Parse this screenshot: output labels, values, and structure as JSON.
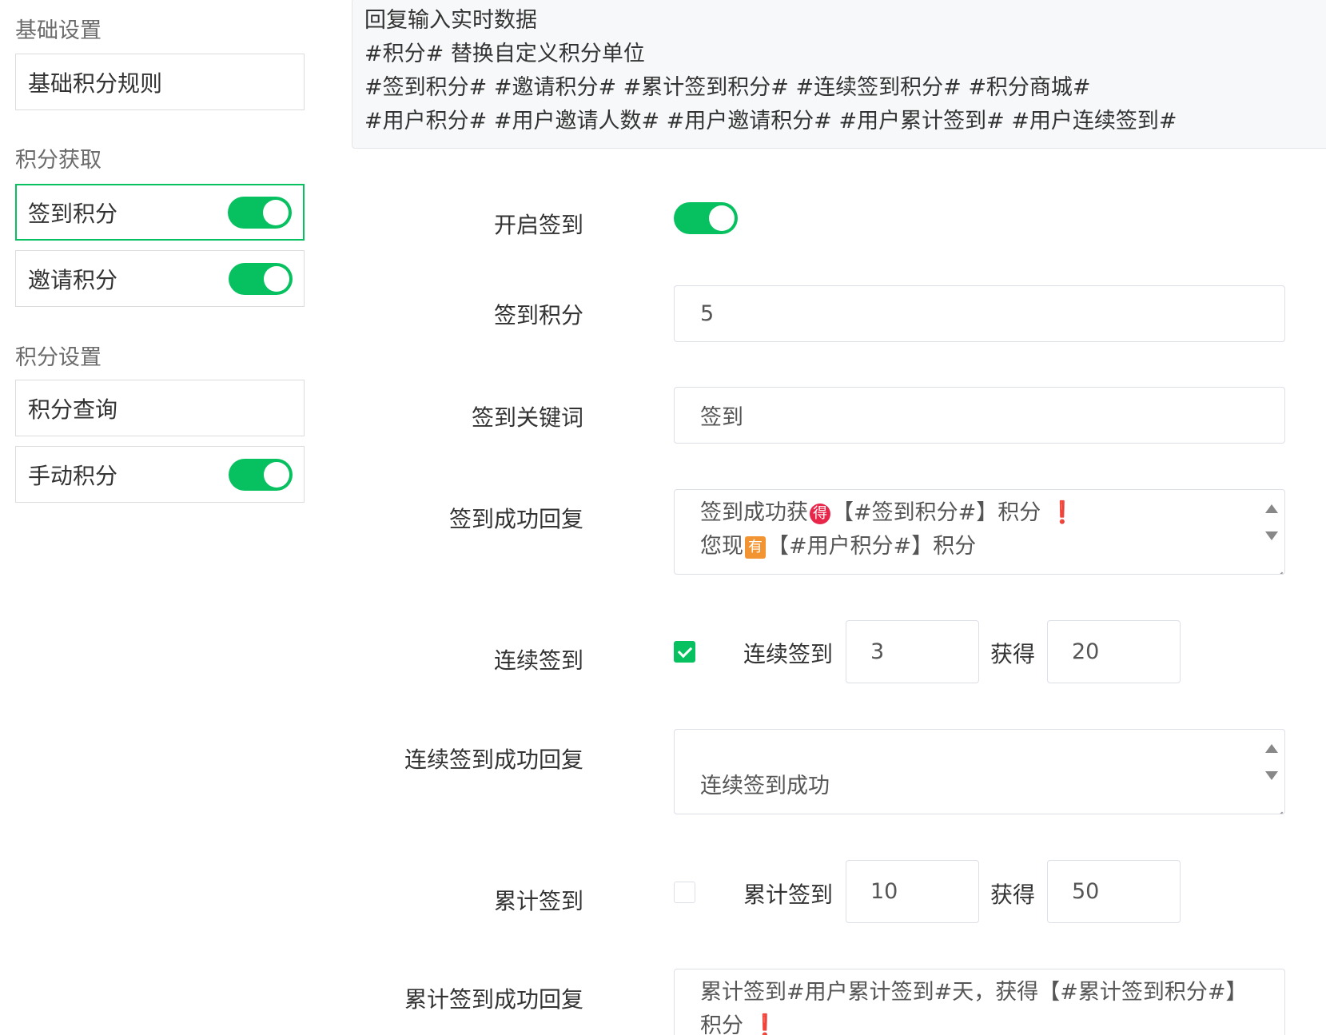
{
  "sidebar": {
    "sections": [
      {
        "title": "基础设置",
        "items": [
          {
            "label": "基础积分规则",
            "toggle": false
          }
        ]
      },
      {
        "title": "积分获取",
        "items": [
          {
            "label": "签到积分",
            "toggle": true,
            "active": true
          },
          {
            "label": "邀请积分",
            "toggle": true
          }
        ]
      },
      {
        "title": "积分设置",
        "items": [
          {
            "label": "积分查询",
            "toggle": false
          },
          {
            "label": "手动积分",
            "toggle": true
          }
        ]
      }
    ]
  },
  "hint": {
    "lines": [
      "回复输入实时数据",
      "#积分# 替换自定义积分单位",
      "#签到积分# #邀请积分# #累计签到积分# #连续签到积分# #积分商城#",
      "#用户积分# #用户邀请人数# #用户邀请积分# #用户累计签到# #用户连续签到#"
    ]
  },
  "form": {
    "enable_checkin": {
      "label": "开启签到",
      "on": true
    },
    "checkin_points": {
      "label": "签到积分",
      "value": "5"
    },
    "checkin_keyword": {
      "label": "签到关键词",
      "value": "签到"
    },
    "checkin_reply": {
      "label": "签到成功回复",
      "line1_a": "签到成功获",
      "line1_emoji": "得",
      "line1_b": "【#签到积分#】积分",
      "line1_excl": "❗",
      "line2_a": "您现",
      "line2_emoji": "有",
      "line2_b": "【#用户积分#】积分"
    },
    "consecutive": {
      "label": "连续签到",
      "checked": true,
      "text1": "连续签到",
      "days": "3",
      "text2": "获得",
      "points": "20"
    },
    "consecutive_reply": {
      "label": "连续签到成功回复",
      "line1": "连续签到成功"
    },
    "cumulative": {
      "label": "累计签到",
      "checked": false,
      "text1": "累计签到",
      "days": "10",
      "text2": "获得",
      "points": "50"
    },
    "cumulative_reply": {
      "label": "累计签到成功回复",
      "line1": "累计签到#用户累计签到#天，获得【#累计签到积分#】",
      "line2": "积分",
      "line2_excl": "❗"
    }
  }
}
